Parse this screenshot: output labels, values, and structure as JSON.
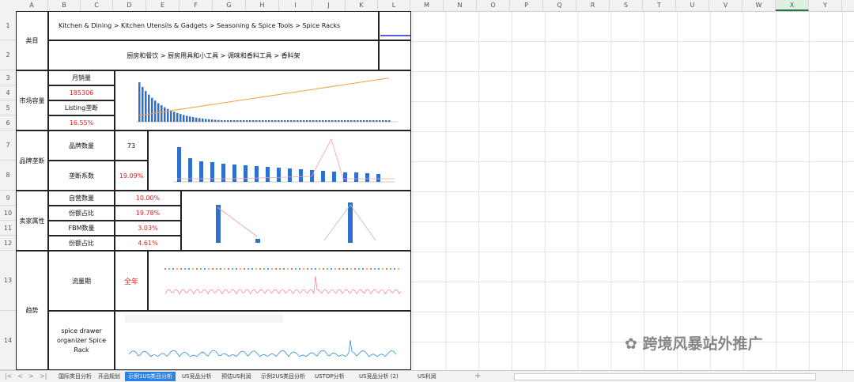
{
  "columns": [
    "A",
    "B",
    "C",
    "D",
    "E",
    "F",
    "G",
    "H",
    "I",
    "J",
    "K",
    "L",
    "M",
    "N",
    "O",
    "P",
    "Q",
    "R",
    "S",
    "T",
    "U",
    "V",
    "W",
    "X",
    "Y"
  ],
  "selected_column": "X",
  "rows": [
    "1",
    "2",
    "3",
    "4",
    "5",
    "6",
    "7",
    "8",
    "9",
    "10",
    "11",
    "12",
    "13",
    "14"
  ],
  "category": {
    "label": "类目",
    "path_en": "Kitchen & Dining > Kitchen Utensils & Gadgets > Seasoning & Spice Tools > Spice Racks",
    "path_cn": "厨房和餐饮 > 厨房用具和小工具 > 调味和香料工具 > 香料架"
  },
  "market": {
    "label": "市场容量",
    "monthly_sales_label": "月销量",
    "monthly_sales_value": "185306",
    "listing_label": "Listing垄断",
    "listing_value": "16.55%"
  },
  "brand": {
    "label": "品牌垄断",
    "count_label": "品牌数量",
    "count_value": "73",
    "coef_label": "垄断系数",
    "coef_value": "19.09%"
  },
  "seller": {
    "label": "卖家属性",
    "self_label": "自营数量",
    "self_value": "10.00%",
    "share1_label": "份额占比",
    "share1_value": "19.78%",
    "fbm_label": "FBM数量",
    "fbm_value": "3.03%",
    "share2_label": "份额占比",
    "share2_value": "4.61%"
  },
  "trend": {
    "label": "趋势",
    "flow_label": "流量期",
    "flow_value": "全年",
    "keyword": "spice drawer organizer Spice Rack"
  },
  "sheet_tabs": [
    "国际类目分析",
    "开品规划",
    "示例1US类目分析",
    "US竞品分析",
    "预估US利润",
    "示例2US类目分析",
    "USTOP分析",
    "US竞品分析 (2)",
    "US利润"
  ],
  "active_tab": "示例1US类目分析",
  "watermark": "跨境风暴站外推广",
  "colors": {
    "accent": "#2a82e4",
    "red": "#e02020",
    "bar": "#2f6fd0",
    "line": "#f0a040"
  }
}
